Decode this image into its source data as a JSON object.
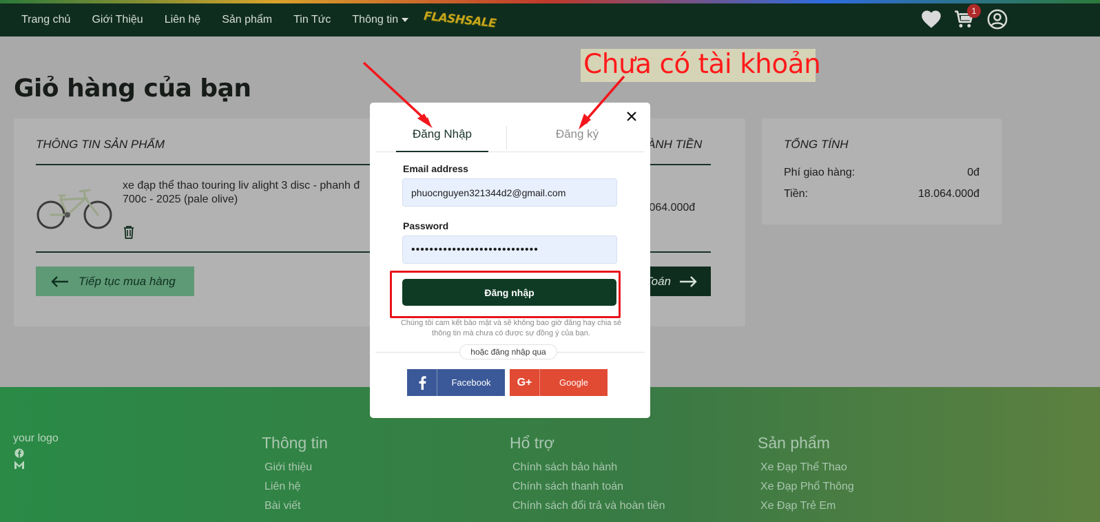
{
  "nav": {
    "items": [
      "Trang chủ",
      "Giới Thiệu",
      "Liên hệ",
      "Sản phẩm",
      "Tin Tức",
      "Thông tin"
    ],
    "flashsale": "FLASHSALE",
    "cart_count": "1"
  },
  "page": {
    "title": "Giỏ hàng của bạn"
  },
  "cart": {
    "header_product": "THÔNG TIN SẢN PHẨM",
    "header_total": "ÀNH TIỀN",
    "product_name": "xe đạp thể thao touring liv alight 3 disc - phanh đ 700c - 2025 (pale olive)",
    "line_total": ".064.000đ",
    "continue_label": "Tiếp tục mua hàng",
    "pay_label": "Toán"
  },
  "summary": {
    "title": "TỔNG TÍNH",
    "shipping_label": "Phí giao hàng:",
    "shipping_value": "0đ",
    "money_label": "Tiền:",
    "money_value": "18.064.000đ"
  },
  "annotation": {
    "note": "Chưa có tài khoản"
  },
  "modal": {
    "tab_login": "Đăng Nhập",
    "tab_register": "Đăng ký",
    "email_label": "Email address",
    "email_value": "phuocnguyen321344d2@gmail.com",
    "password_label": "Password",
    "password_value": "••••••••••••••••••••••••••••",
    "login_button": "Đăng nhập",
    "privacy_text": "Chúng tôi cam kết bảo mật và sẽ không bao giờ đăng hay chia sẻ thông tin mà chưa có được sự đồng ý của bạn.",
    "or_text": "hoặc đăng nhập qua",
    "facebook": "Facebook",
    "google": "Google"
  },
  "footer": {
    "logo": "your logo",
    "col1_title": "Thông tin",
    "col1_links": [
      "Giới thiệu",
      "Liên hệ",
      "Bài viết"
    ],
    "col2_title": "Hổ trợ",
    "col2_links": [
      "Chính sách bảo hành",
      "Chính sách thanh toán",
      "Chính sách đổi trả và hoàn tiền"
    ],
    "col3_title": "Sản phẩm",
    "col3_links": [
      "Xe Đạp Thể Thao",
      "Xe Đạp Phổ Thông",
      "Xe Đạp Trẻ Em"
    ]
  },
  "colors": {
    "nav_bg": "#0f2d1e",
    "accent": "#0f3b25",
    "annotation_red": "#e8131b"
  }
}
